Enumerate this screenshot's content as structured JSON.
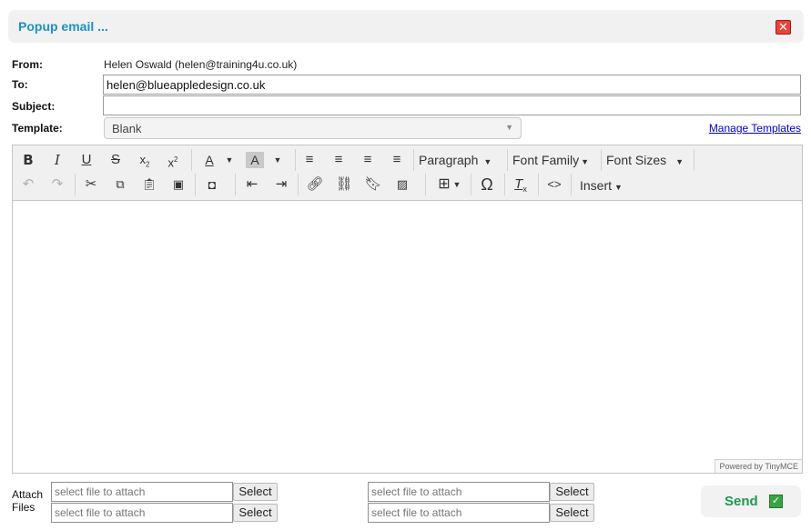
{
  "dialog": {
    "title": "Popup email ...",
    "close_icon": "close-icon"
  },
  "from": {
    "label": "From:",
    "value": "Helen Oswald (helen@training4u.co.uk)"
  },
  "to": {
    "label": "To:",
    "value": "helen@blueappledesign.co.uk"
  },
  "subject": {
    "label": "Subject:",
    "value": ""
  },
  "template": {
    "label": "Template:",
    "selected": "Blank",
    "manage_link": "Manage Templates"
  },
  "toolbar": {
    "paragraph": "Paragraph",
    "font_family": "Font Family",
    "font_sizes": "Font Sizes",
    "insert": "Insert"
  },
  "editor": {
    "powered_by": "Powered by TinyMCE"
  },
  "attach": {
    "label_line1": "Attach",
    "label_line2": "Files",
    "placeholder": "select file to attach",
    "select_label": "Select"
  },
  "send": {
    "label": "Send"
  },
  "colors": {
    "title": "#1f8fc6",
    "send": "#1a9a56",
    "close": "#e8433a",
    "link": "#0000cc"
  }
}
